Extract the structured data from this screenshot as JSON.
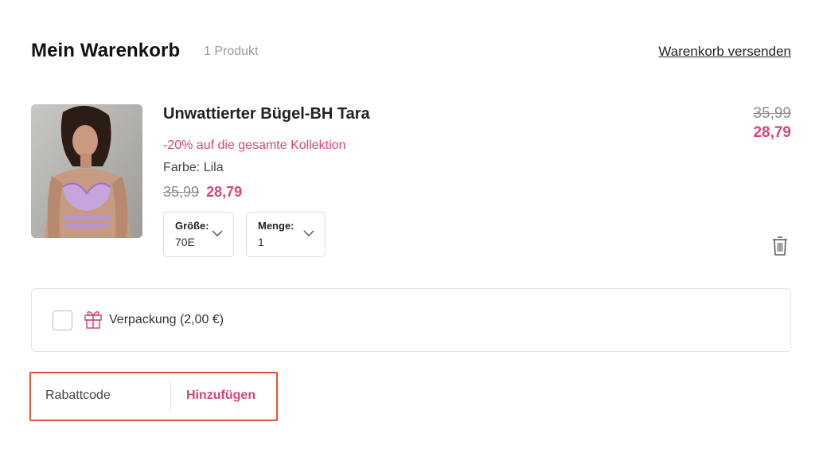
{
  "header": {
    "title": "Mein Warenkorb",
    "count": "1 Produkt",
    "send_link": "Warenkorb versenden"
  },
  "product": {
    "name": "Unwattierter Bügel-BH Tara",
    "promo": "-20% auf die gesamte Kollektion",
    "color": "Farbe: Lila",
    "old_price": "35,99",
    "new_price": "28,79",
    "size": {
      "label": "Größe:",
      "value": "70E"
    },
    "quantity": {
      "label": "Menge:",
      "value": "1"
    }
  },
  "line_total": {
    "old": "35,99",
    "new": "28,79"
  },
  "gift_wrap": {
    "label": "Verpackung (2,00 €)",
    "checked": false
  },
  "coupon": {
    "placeholder": "Rabattcode",
    "button": "Hinzufügen"
  },
  "colors": {
    "accent": "#d6457a",
    "highlight_border": "#e0523b",
    "strike_gray": "#8c8c8c"
  },
  "icons": [
    "chevron-down-icon",
    "trash-icon",
    "gift-icon"
  ]
}
